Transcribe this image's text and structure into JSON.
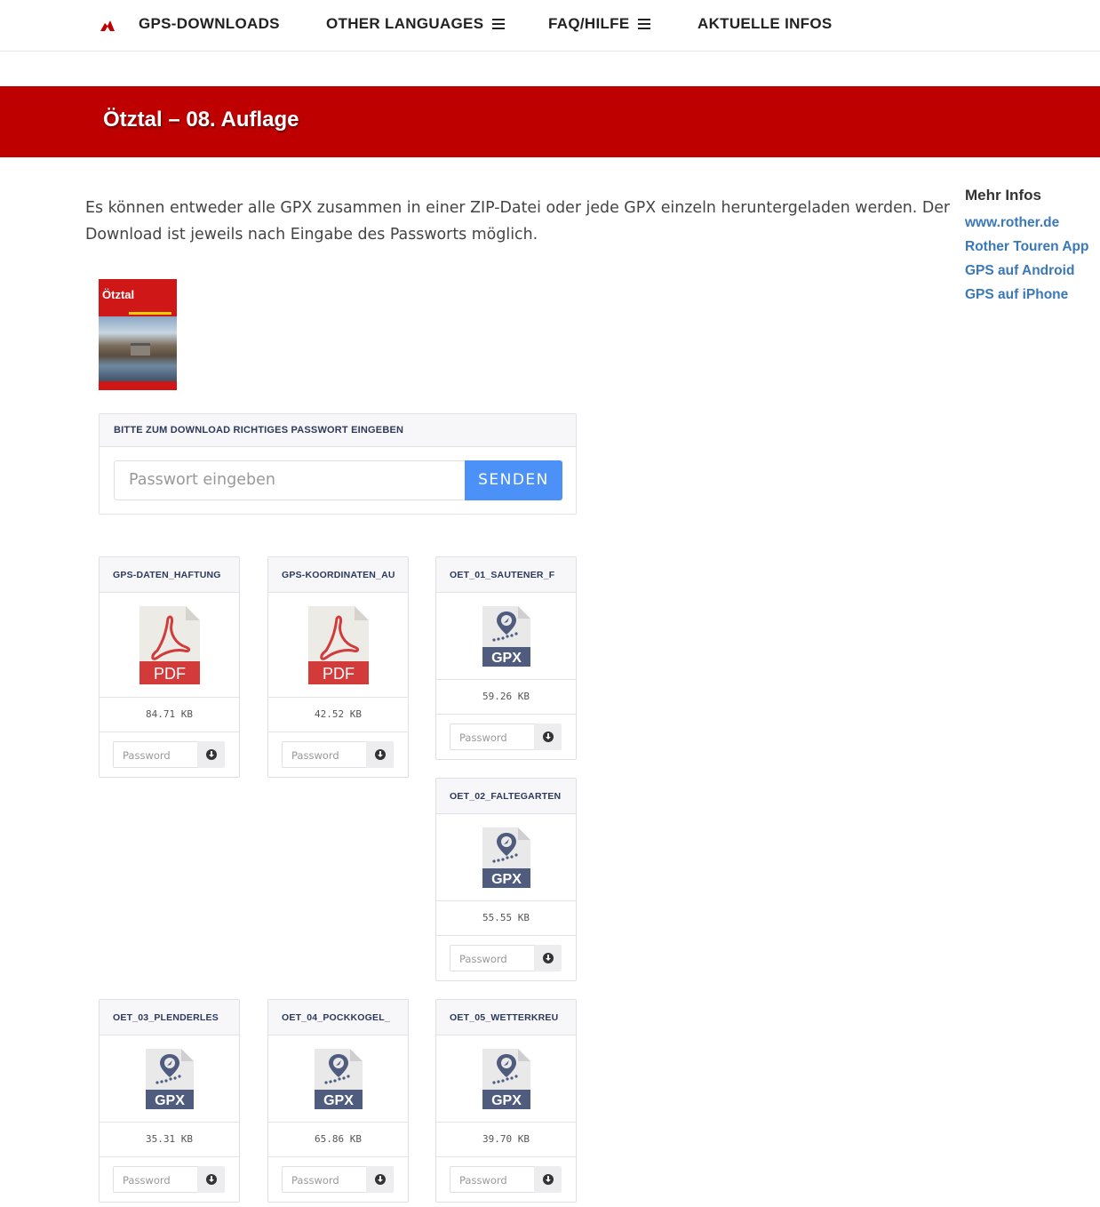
{
  "nav": {
    "items": [
      {
        "label": "GPS-DOWNLOADS"
      },
      {
        "label": "OTHER LANGUAGES"
      },
      {
        "label": "FAQ/HILFE"
      },
      {
        "label": "AKTUELLE INFOS"
      }
    ]
  },
  "banner": {
    "title": "Ötztal – 08. Auflage"
  },
  "intro": {
    "text": "Es können entweder alle GPX zusammen in einer ZIP-Datei oder jede GPX einzeln heruntergeladen werden. Der Download ist jeweils nach Eingabe des Passworts möglich."
  },
  "sidebar": {
    "heading": "Mehr Infos",
    "links": [
      "www.rother.de",
      "Rother Touren App",
      "GPS auf Android",
      "GPS auf iPhone"
    ]
  },
  "cover": {
    "title": "Ötztal"
  },
  "password_box": {
    "heading": "BITTE ZUM DOWNLOAD RICHTIGES PASSWORT EINGEBEN",
    "placeholder": "Passwort eingeben",
    "submit_label": "SENDEN"
  },
  "files": [
    {
      "name": "GPS-DATEN_HAFTUNG",
      "type": "PDF",
      "size": "84.71 KB",
      "placeholder": "Password"
    },
    {
      "name": "GPS-KOORDINATEN_AU",
      "type": "PDF",
      "size": "42.52 KB",
      "placeholder": "Password"
    },
    {
      "name": "OET_01_SAUTENER_F",
      "type": "GPX",
      "size": "59.26 KB",
      "placeholder": "Password"
    },
    {
      "name": "OET_02_FALTEGARTEN",
      "type": "GPX",
      "size": "55.55 KB",
      "placeholder": "Password"
    },
    {
      "name": "OET_03_PLENDERLES",
      "type": "GPX",
      "size": "35.31 KB",
      "placeholder": "Password"
    },
    {
      "name": "OET_04_POCKKOGEL_",
      "type": "GPX",
      "size": "65.86 KB",
      "placeholder": "Password"
    },
    {
      "name": "OET_05_WETTERKREU",
      "type": "GPX",
      "size": "39.70 KB",
      "placeholder": "Password"
    }
  ],
  "colors": {
    "brand": "#bf0000",
    "accent": "#4b91f7",
    "link": "#3a78b8"
  }
}
